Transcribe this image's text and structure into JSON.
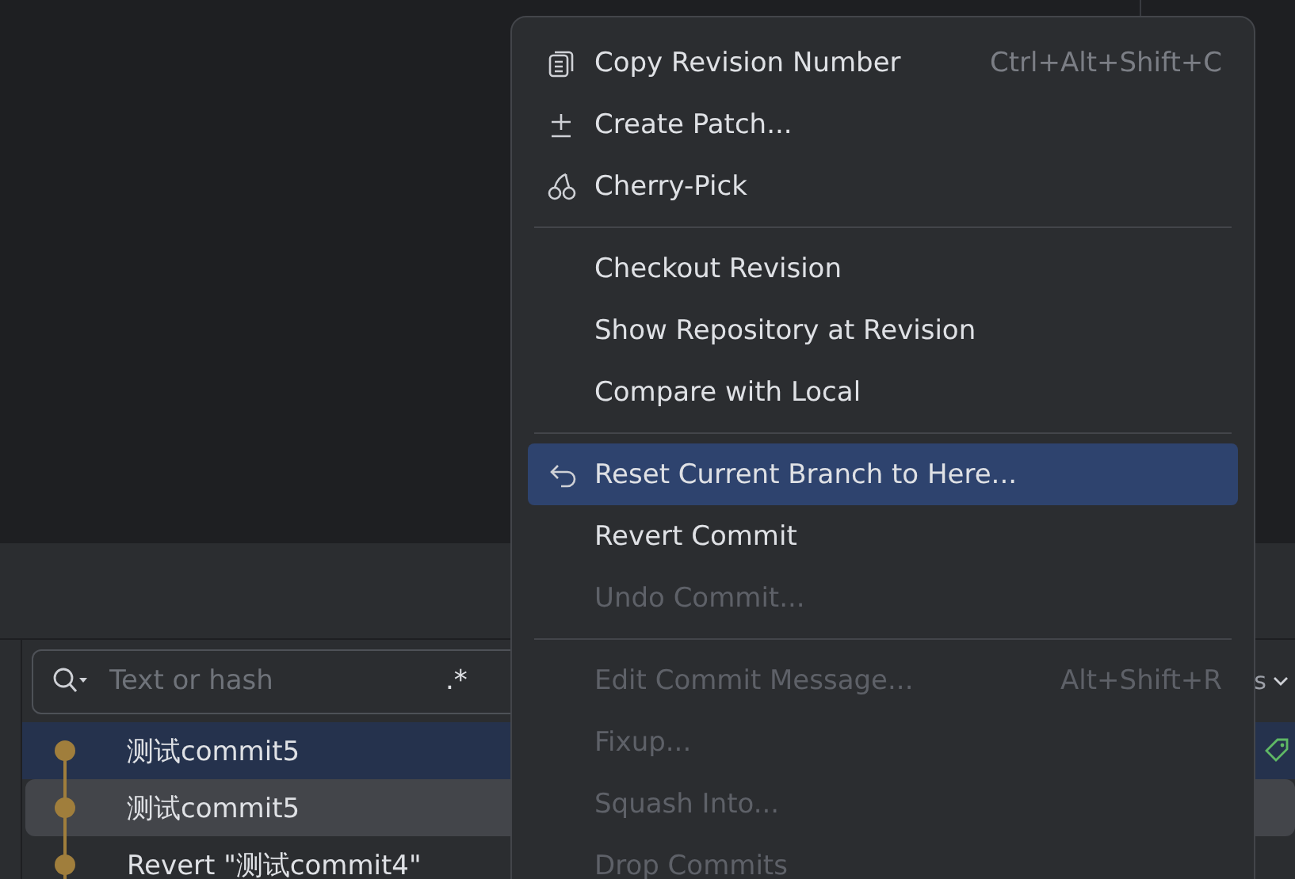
{
  "search": {
    "placeholder": "Text or hash",
    "regex_toggle": ".*"
  },
  "toolbar_partial_text": "s",
  "commits": [
    {
      "message": "测试commit5",
      "selected": true,
      "hovered": false,
      "tag": true
    },
    {
      "message": "测试commit5",
      "selected": false,
      "hovered": true,
      "tag": false
    },
    {
      "message": "Revert \"测试commit4\"",
      "selected": false,
      "hovered": false,
      "tag": false
    }
  ],
  "context_menu": {
    "items": [
      {
        "kind": "item",
        "label": "Copy Revision Number",
        "shortcut": "Ctrl+Alt+Shift+C",
        "disabled": false,
        "selected": false
      },
      {
        "kind": "item",
        "label": "Create Patch...",
        "disabled": false,
        "selected": false
      },
      {
        "kind": "item",
        "label": "Cherry-Pick",
        "disabled": false,
        "selected": false
      },
      {
        "kind": "separator"
      },
      {
        "kind": "item",
        "label": "Checkout Revision",
        "disabled": false,
        "selected": false
      },
      {
        "kind": "item",
        "label": "Show Repository at Revision",
        "disabled": false,
        "selected": false
      },
      {
        "kind": "item",
        "label": "Compare with Local",
        "disabled": false,
        "selected": false
      },
      {
        "kind": "separator"
      },
      {
        "kind": "item",
        "label": "Reset Current Branch to Here...",
        "disabled": false,
        "selected": true
      },
      {
        "kind": "item",
        "label": "Revert Commit",
        "disabled": false,
        "selected": false
      },
      {
        "kind": "item",
        "label": "Undo Commit...",
        "disabled": true,
        "selected": false
      },
      {
        "kind": "separator"
      },
      {
        "kind": "item",
        "label": "Edit Commit Message...",
        "shortcut": "Alt+Shift+R",
        "disabled": true,
        "selected": false
      },
      {
        "kind": "item",
        "label": "Fixup...",
        "disabled": true,
        "selected": false
      },
      {
        "kind": "item",
        "label": "Squash Into...",
        "disabled": true,
        "selected": false
      },
      {
        "kind": "item",
        "label": "Drop Commits",
        "disabled": true,
        "selected": false
      }
    ]
  }
}
